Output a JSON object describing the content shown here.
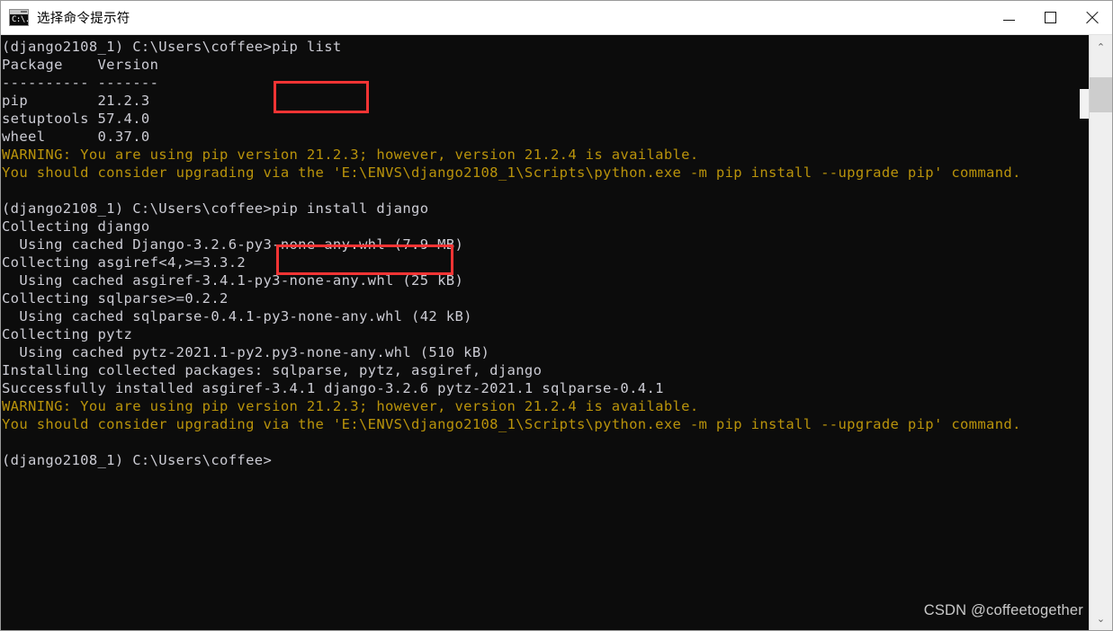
{
  "window": {
    "title": "选择命令提示符",
    "icon": "cmd-icon",
    "icon_glyph": "C:\\.",
    "controls": {
      "minimize_label": "最小化",
      "maximize_label": "最大化",
      "close_label": "关闭"
    }
  },
  "console": {
    "background_color": "#0c0c0c",
    "text_color": "#ccccd4",
    "warning_color": "#b9930b",
    "lines": [
      {
        "kind": "prompt",
        "text": "(django2108_1) C:\\Users\\coffee>pip list"
      },
      {
        "kind": "out",
        "text": "Package    Version"
      },
      {
        "kind": "out",
        "text": "---------- -------"
      },
      {
        "kind": "out",
        "text": "pip        21.2.3"
      },
      {
        "kind": "out",
        "text": "setuptools 57.4.0"
      },
      {
        "kind": "out",
        "text": "wheel      0.37.0"
      },
      {
        "kind": "warn",
        "text": "WARNING: You are using pip version 21.2.3; however, version 21.2.4 is available."
      },
      {
        "kind": "warn",
        "text": "You should consider upgrading via the 'E:\\ENVS\\django2108_1\\Scripts\\python.exe -m pip install --upgrade pip' command."
      },
      {
        "kind": "out",
        "text": ""
      },
      {
        "kind": "prompt",
        "text": "(django2108_1) C:\\Users\\coffee>pip install django"
      },
      {
        "kind": "out",
        "text": "Collecting django"
      },
      {
        "kind": "out",
        "text": "  Using cached Django-3.2.6-py3-none-any.whl (7.9 MB)"
      },
      {
        "kind": "out",
        "text": "Collecting asgiref<4,>=3.3.2"
      },
      {
        "kind": "out",
        "text": "  Using cached asgiref-3.4.1-py3-none-any.whl (25 kB)"
      },
      {
        "kind": "out",
        "text": "Collecting sqlparse>=0.2.2"
      },
      {
        "kind": "out",
        "text": "  Using cached sqlparse-0.4.1-py3-none-any.whl (42 kB)"
      },
      {
        "kind": "out",
        "text": "Collecting pytz"
      },
      {
        "kind": "out",
        "text": "  Using cached pytz-2021.1-py2.py3-none-any.whl (510 kB)"
      },
      {
        "kind": "out",
        "text": "Installing collected packages: sqlparse, pytz, asgiref, django"
      },
      {
        "kind": "out",
        "text": "Successfully installed asgiref-3.4.1 django-3.2.6 pytz-2021.1 sqlparse-0.4.1"
      },
      {
        "kind": "warn",
        "text": "WARNING: You are using pip version 21.2.3; however, version 21.2.4 is available."
      },
      {
        "kind": "warn",
        "text": "You should consider upgrading via the 'E:\\ENVS\\django2108_1\\Scripts\\python.exe -m pip install --upgrade pip' command."
      },
      {
        "kind": "out",
        "text": ""
      },
      {
        "kind": "prompt",
        "text": "(django2108_1) C:\\Users\\coffee>"
      }
    ]
  },
  "annotations": {
    "color": "#f53434",
    "boxes": [
      {
        "id": "redbox-pip-list",
        "label": "pip list"
      },
      {
        "id": "redbox-pip-install",
        "label": "pip install django"
      }
    ]
  },
  "watermark": {
    "text": "CSDN @coffeetogether"
  },
  "scrollbar": {
    "up_arrow": "⌃",
    "down_arrow": "⌄"
  }
}
